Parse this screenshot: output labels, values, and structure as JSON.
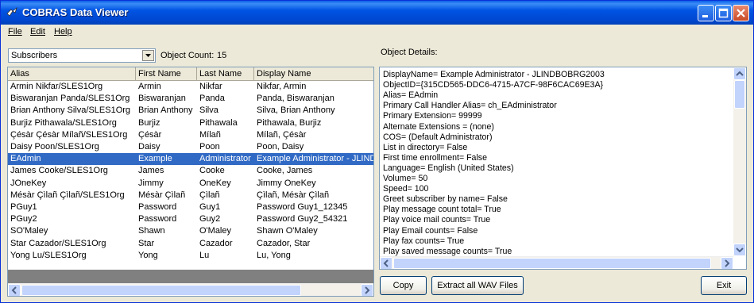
{
  "window": {
    "title": "COBRAS Data Viewer"
  },
  "menu": {
    "file": "File",
    "edit": "Edit",
    "help": "Help"
  },
  "filter": {
    "selected": "Subscribers",
    "count_label": "Object Count:",
    "count_value": "15"
  },
  "details_label": "Object Details:",
  "table": {
    "columns": [
      "Alias",
      "First Name",
      "Last Name",
      "Display Name"
    ],
    "rows": [
      [
        "Armin Nikfar/SLES1Org",
        "Armin",
        "Nikfar",
        "Nikfar, Armin"
      ],
      [
        "Biswaranjan Panda/SLES1Org",
        "Biswaranjan",
        "Panda",
        "Panda, Biswaranjan"
      ],
      [
        "Brian Anthony Silva/SLES1Org",
        "Brian Anthony",
        "Silva",
        "Silva, Brian Anthony"
      ],
      [
        "Burjiz Pithawala/SLES1Org",
        "Burjiz",
        "Pithawala",
        "Pithawala, Burjiz"
      ],
      [
        "Çésàr Çésàr Mílañ/SLES1Org",
        "Çésàr",
        "Mílañ",
        "Mílañ, Çésàr"
      ],
      [
        "Daisy Poon/SLES1Org",
        "Daisy",
        "Poon",
        "Poon, Daisy"
      ],
      [
        "EAdmin",
        "Example",
        "Administrator",
        "Example Administrator - JLINDE"
      ],
      [
        "James Cooke/SLES1Org",
        "James",
        "Cooke",
        "Cooke, James"
      ],
      [
        "JOneKey",
        "Jimmy",
        "OneKey",
        "Jimmy OneKey"
      ],
      [
        "Mésàr Çìlañ Çìlañ/SLES1Org",
        "Mésàr Çìlañ",
        "Çìlañ",
        "Çìlañ, Mésàr Çìlañ"
      ],
      [
        "PGuy1",
        "Password",
        "Guy1",
        "Password Guy1_12345"
      ],
      [
        "PGuy2",
        "Password",
        "Guy2",
        "Password Guy2_54321"
      ],
      [
        "SO'Maley",
        "Shawn",
        "O'Maley",
        "Shawn  O'Maley"
      ],
      [
        "Star Cazador/SLES1Org",
        "Star",
        "Cazador",
        "Cazador, Star"
      ],
      [
        "Yong Lu/SLES1Org",
        "Yong",
        "Lu",
        "Lu, Yong"
      ]
    ],
    "selected_index": 6
  },
  "details": [
    "DisplayName= Example Administrator - JLINDBOBRG2003",
    "ObjectID={315CD565-DDC6-4715-A7CF-98F6CAC69E3A}",
    "Alias= EAdmin",
    "Primary Call Handler Alias= ch_EAdministrator",
    "Primary Extension= 99999",
    "Alternate Extensions = (none)",
    "COS= (Default Administrator)",
    "List in directory= False",
    "First time enrollment= False",
    "Language= English (United States)",
    "Volume=  50",
    "Speed=  100",
    "Greet subscriber by name= False",
    "Play message count total= True",
    "Play voice mail counts= True",
    "Play Email counts= False",
    "Play fax counts= True",
    "Play saved message counts= True"
  ],
  "buttons": {
    "copy": "Copy",
    "extract": "Extract all WAV Files",
    "exit": "Exit"
  },
  "colors": {
    "selection": "#316AC5",
    "titlebar": "#0054E3",
    "face": "#ECE9D8"
  }
}
